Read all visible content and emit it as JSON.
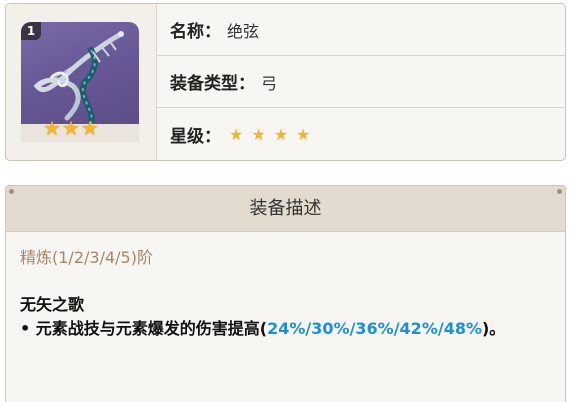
{
  "weapon": {
    "icon_name": "bow-icon",
    "level_badge": "1",
    "icon_stars": 3
  },
  "info": {
    "name_label": "名称：",
    "name_value": "绝弦",
    "type_label": "装备类型：",
    "type_value": "弓",
    "rarity_label": "星级：",
    "rarity_stars": 4
  },
  "description": {
    "header": "装备描述",
    "refinement": "精炼(1/2/3/4/5)阶",
    "skill_title": "无矢之歌",
    "skill_prefix": "• 元素战技与元素爆发的伤害提高(",
    "skill_values": "24%/30%/36%/42%/48%",
    "skill_suffix": ")。"
  },
  "colors": {
    "star": "#f2b431",
    "value_highlight": "#1a91d8",
    "refinement_text": "#a5876a",
    "panel_border": "#cfc3b4"
  }
}
